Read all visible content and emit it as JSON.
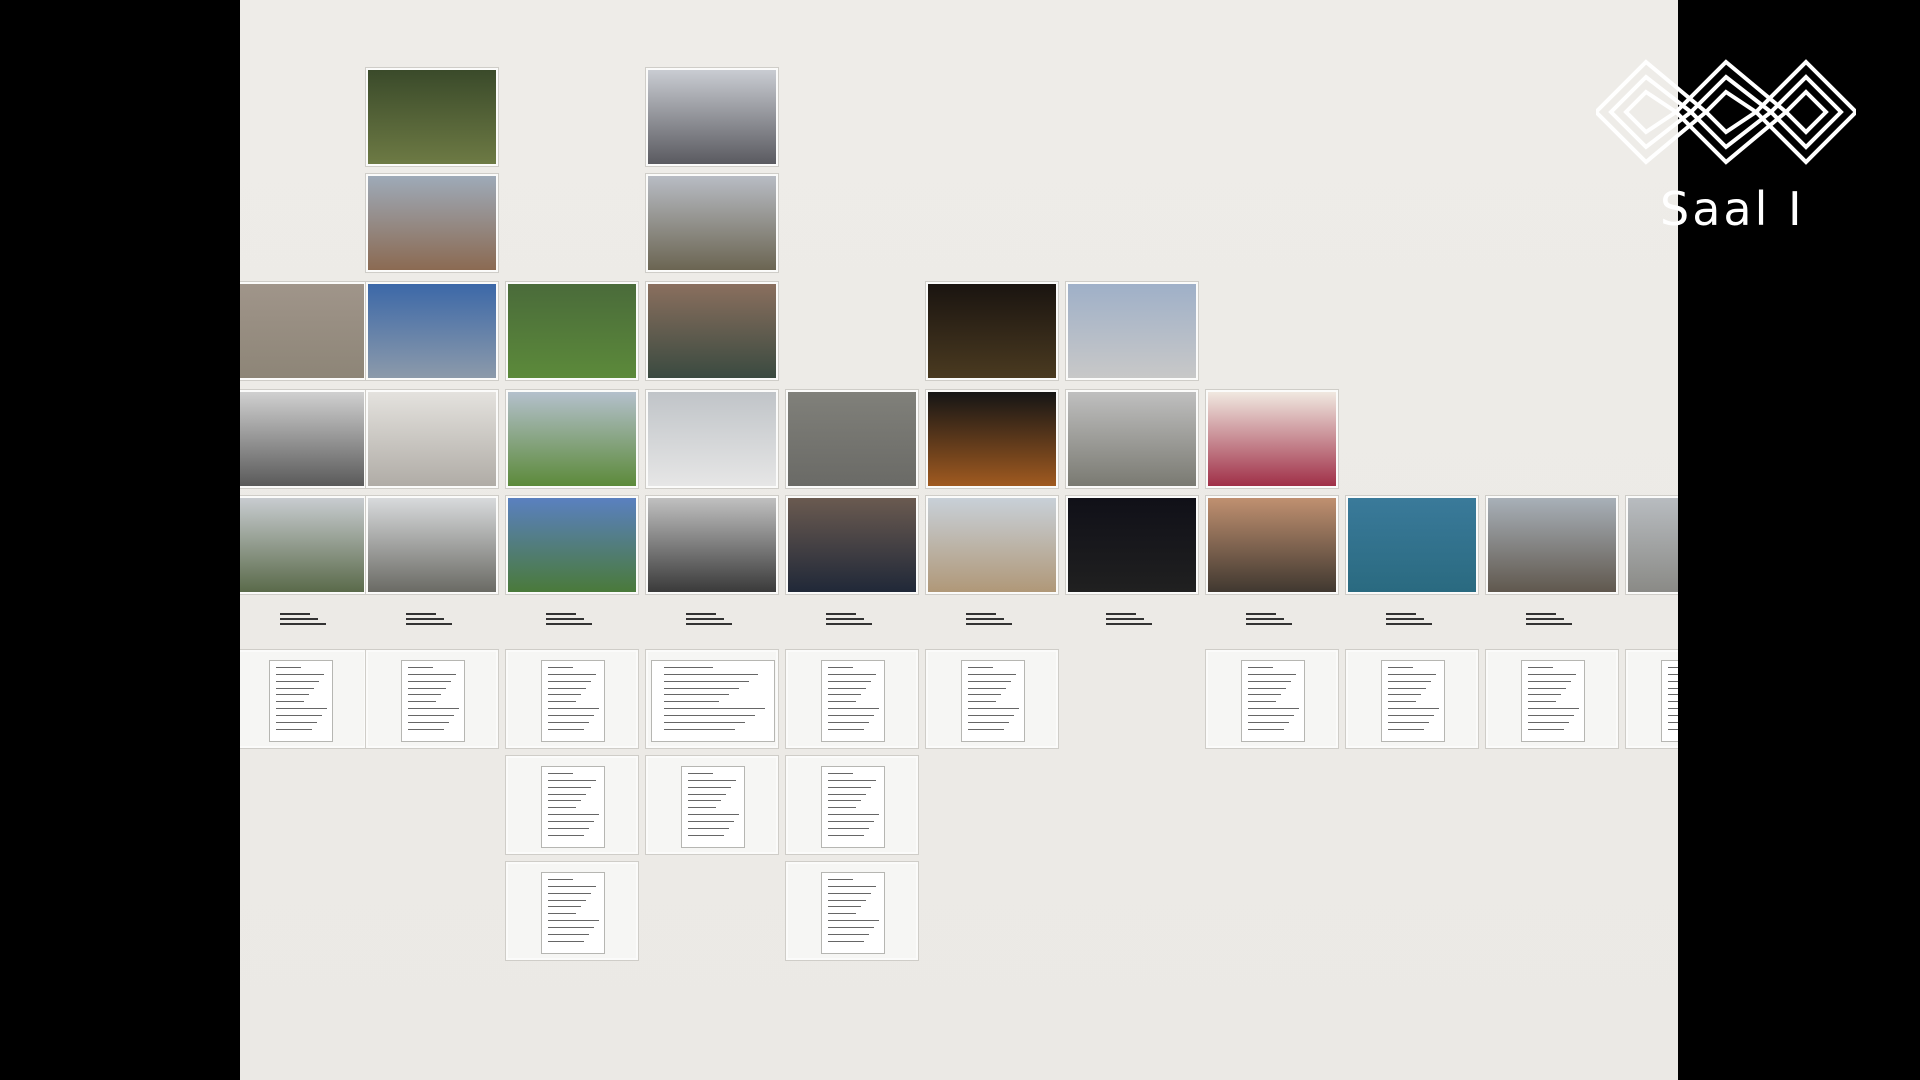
{
  "overlay": {
    "hall_label": "Saal I"
  },
  "scene": {
    "description_kind": "slide",
    "photo_colors": {
      "tree": "#3a4a2a",
      "sky": "#9eaab8",
      "night": "#1a1410",
      "building": "#8d8577",
      "green": "#5c8a3a",
      "blue": "#3c68a8",
      "car": "#202838"
    },
    "icons": [
      "logo-icon"
    ]
  }
}
